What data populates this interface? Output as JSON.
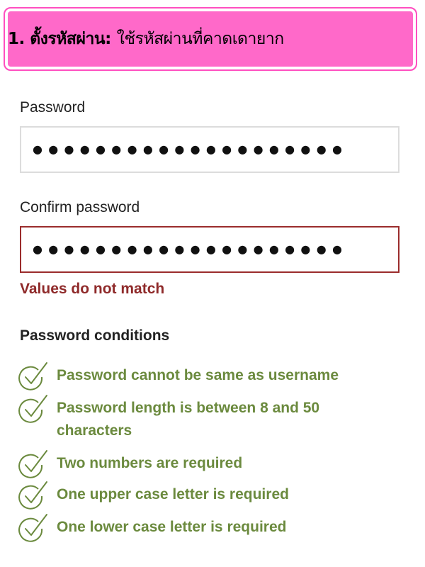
{
  "banner": {
    "title_bold": "1. ตั้งรหัสผ่าน:",
    "title_rest": "ใช้รหัสผ่านที่คาดเดายาก"
  },
  "password": {
    "label": "Password",
    "masked_value": "●●●●●●●●●●●●●●●●●●●●"
  },
  "confirm_password": {
    "label": "Confirm password",
    "masked_value": "●●●●●●●●●●●●●●●●●●●●",
    "error": "Values do not match"
  },
  "conditions": {
    "title": "Password conditions",
    "icon": "check-circle-icon",
    "color": "#6b8a3e",
    "items": [
      "Password cannot be same as username",
      "Password length is between 8 and 50 characters",
      "Two numbers are required",
      "One upper case letter is required",
      "One lower case letter is required"
    ]
  },
  "colors": {
    "banner": "#ff69c9",
    "error": "#8f2a2a",
    "success": "#6b8a3e"
  }
}
